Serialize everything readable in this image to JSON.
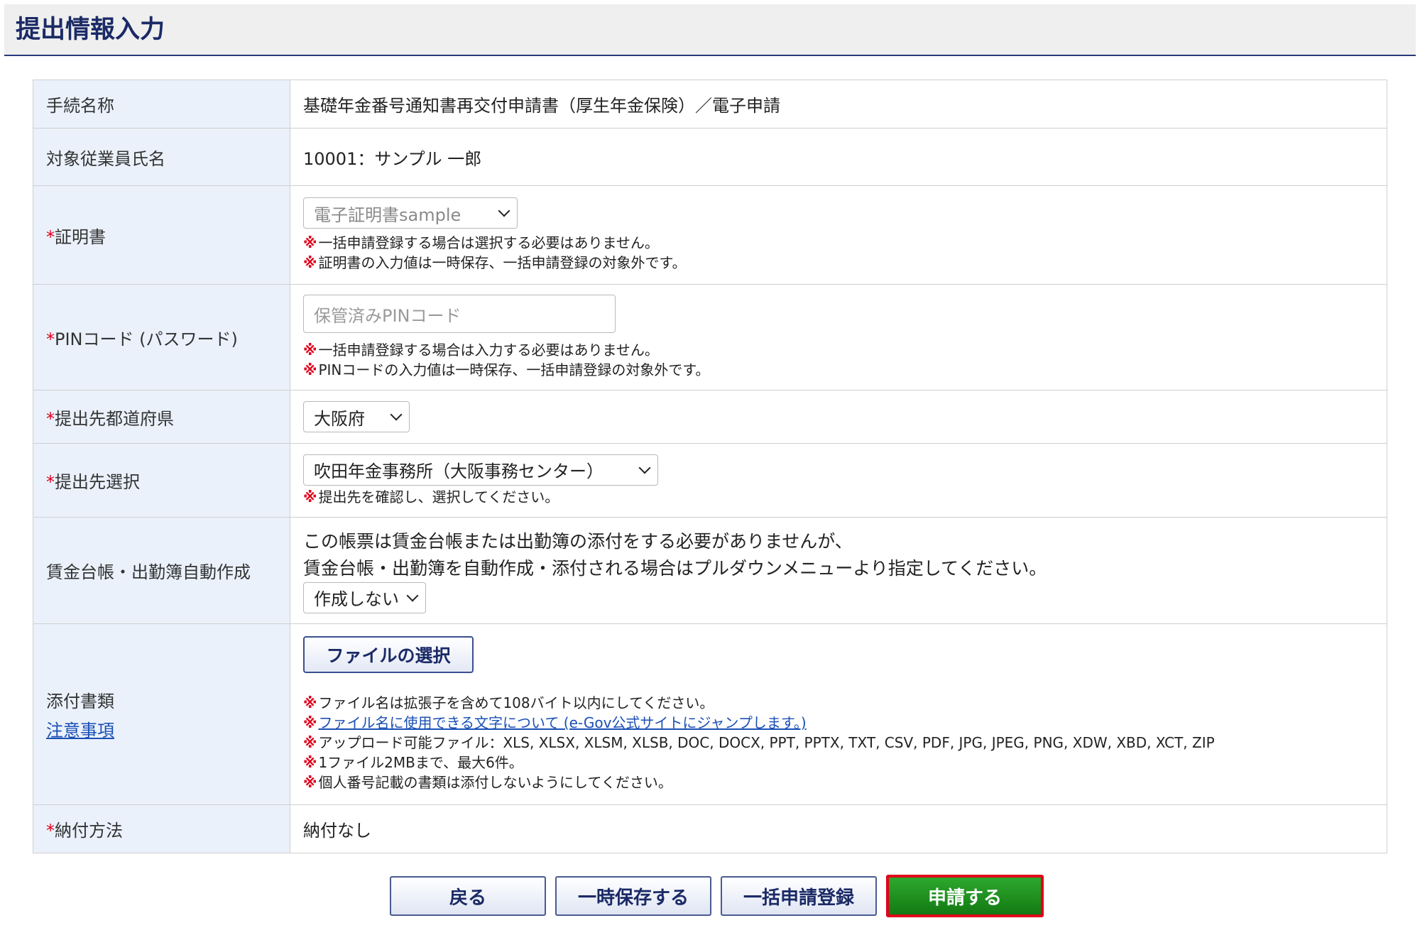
{
  "page_title": "提出情報入力",
  "required_mark": "*",
  "note_mark": "※",
  "colors": {
    "accent": "#1b2a66",
    "required": "#e0001b",
    "primary_button": "#1e8f1e",
    "label_bg": "#eaf1fb"
  },
  "rows": {
    "procedure": {
      "label": "手続名称",
      "value": "基礎年金番号通知書再交付申請書（厚生年金保険）／電子申請"
    },
    "employee": {
      "label": "対象従業員氏名",
      "value": "10001：サンプル 一郎"
    },
    "certificate": {
      "label": "証明書",
      "selected": "電子証明書sample",
      "notes": [
        "一括申請登録する場合は選択する必要はありません。",
        "証明書の入力値は一時保存、一括申請登録の対象外です。"
      ]
    },
    "pin": {
      "label": "PINコード (パスワード)",
      "placeholder": "保管済みPINコード",
      "notes": [
        "一括申請登録する場合は入力する必要はありません。",
        "PINコードの入力値は一時保存、一括申請登録の対象外です。"
      ]
    },
    "prefecture": {
      "label": "提出先都道府県",
      "selected": "大阪府"
    },
    "destination": {
      "label": "提出先選択",
      "selected": "吹田年金事務所（大阪事務センター）",
      "notes": [
        "提出先を確認し、選択してください。"
      ]
    },
    "wage_ledger": {
      "label": "賃金台帳・出勤簿自動作成",
      "text_line1": "この帳票は賃金台帳または出勤簿の添付をする必要がありませんが、",
      "text_line2": "賃金台帳・出勤簿を自動作成・添付される場合はプルダウンメニューより指定してください。",
      "selected": "作成しない"
    },
    "attachments": {
      "label": "添付書類",
      "link": "注意事項",
      "file_button": "ファイルの選択",
      "notes": [
        "ファイル名は拡張子を含めて108バイト以内にしてください。",
        "ファイル名に使用できる文字について (e-Gov公式サイトにジャンプします。)",
        "アップロード可能ファイル：XLS, XLSX, XLSM, XLSB, DOC, DOCX, PPT, PPTX, TXT, CSV, PDF, JPG, JPEG, PNG, XDW, XBD, XCT, ZIP",
        "1ファイル2MBまで、最大6件。",
        "個人番号記載の書類は添付しないようにしてください。"
      ]
    },
    "payment": {
      "label": "納付方法",
      "value": "納付なし"
    }
  },
  "buttons": {
    "back": "戻る",
    "save": "一時保存する",
    "batch": "一括申請登録",
    "submit": "申請する"
  }
}
